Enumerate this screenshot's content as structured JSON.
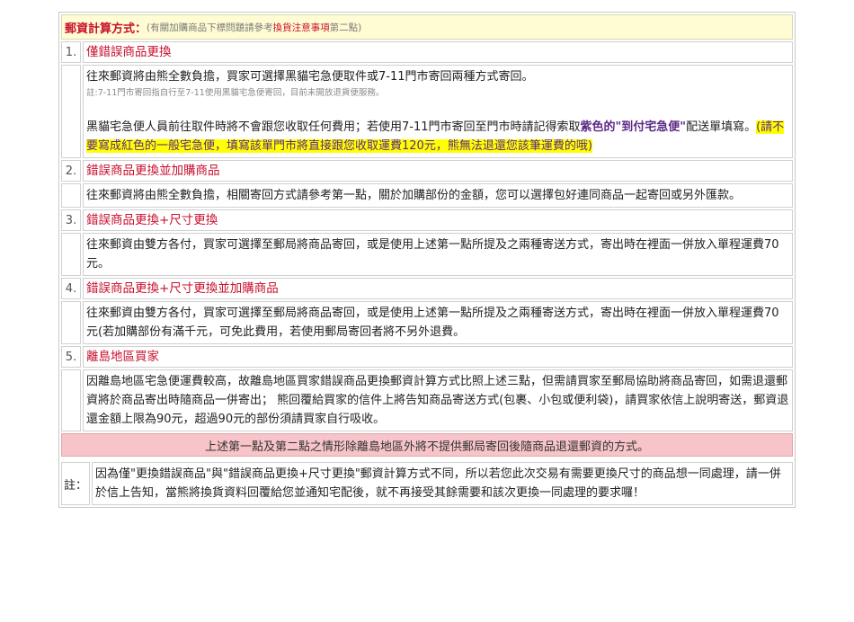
{
  "header": {
    "title": "郵資計算方式：",
    "note_pre": "(有關加購商品下標問題請參考",
    "note_link": "換貨注意事項",
    "note_post": "第二點)"
  },
  "sections": [
    {
      "num": "1.",
      "title": "僅錯誤商品更換",
      "p1": "往來郵資將由熊全數負擔，買家可選擇黑貓宅急便取件或7-11門市寄回兩種方式寄回。",
      "note": "註:7-11門市寄回指自行至7-11使用黑貓宅急便寄回，目前未開放退貨便服務。",
      "p2_a": "黑貓宅急便人員前往取件時將不會跟您收取任何費用；若使用7-11門市寄回至門市時請記得索取",
      "p2_b": "紫色的\"到付宅急便\"",
      "p2_c": "配送單填寫。",
      "p2_hl": "(請不要寫成紅色的一般宅急便，填寫該單門市將直接跟您收取運費120元，熊無法退還您該筆運費的哦)"
    },
    {
      "num": "2.",
      "title": "錯誤商品更換並加購商品",
      "body": "往來郵資將由熊全數負擔，相關寄回方式請參考第一點，關於加購部份的金額，您可以選擇包好連同商品一起寄回或另外匯款。"
    },
    {
      "num": "3.",
      "title": "錯誤商品更換+尺寸更換",
      "body": "往來郵資由雙方各付，買家可選擇至郵局將商品寄回，或是使用上述第一點所提及之兩種寄送方式，寄出時在裡面一併放入單程運費70元。"
    },
    {
      "num": "4.",
      "title": "錯誤商品更換+尺寸更換並加購商品",
      "body": "往來郵資由雙方各付，買家可選擇至郵局將商品寄回，或是使用上述第一點所提及之兩種寄送方式，寄出時在裡面一併放入單程運費70元(若加購部份有滿千元，可免此費用，若使用郵局寄回者將不另外退費。"
    },
    {
      "num": "5.",
      "title": "離島地區買家",
      "body": "因離島地區宅急便運費較高，故離島地區買家錯誤商品更換郵資計算方式比照上述三點，但需請買家至郵局協助將商品寄回，如需退還郵資將於商品寄出時隨商品一併寄出； 熊回覆給買家的信件上將告知商品寄送方式(包裹、小包或便利袋)，請買家依信上說明寄送，郵資退還金額上限為90元，超過90元的部份須請買家自行吸收。"
    }
  ],
  "banner": "上述第一點及第二點之情形除離島地區外將不提供郵局寄回後隨商品退還郵資的方式。",
  "footnote": {
    "label": "註：",
    "text": "因為僅\"更換錯誤商品\"與\"錯誤商品更換+尺寸更換\"郵資計算方式不同，所以若您此次交易有需要更換尺寸的商品想一同處理，請一併於信上告知，當熊將換貨資料回覆給您並通知宅配後，就不再接受其餘需要和該次更換一同處理的要求囉！"
  }
}
